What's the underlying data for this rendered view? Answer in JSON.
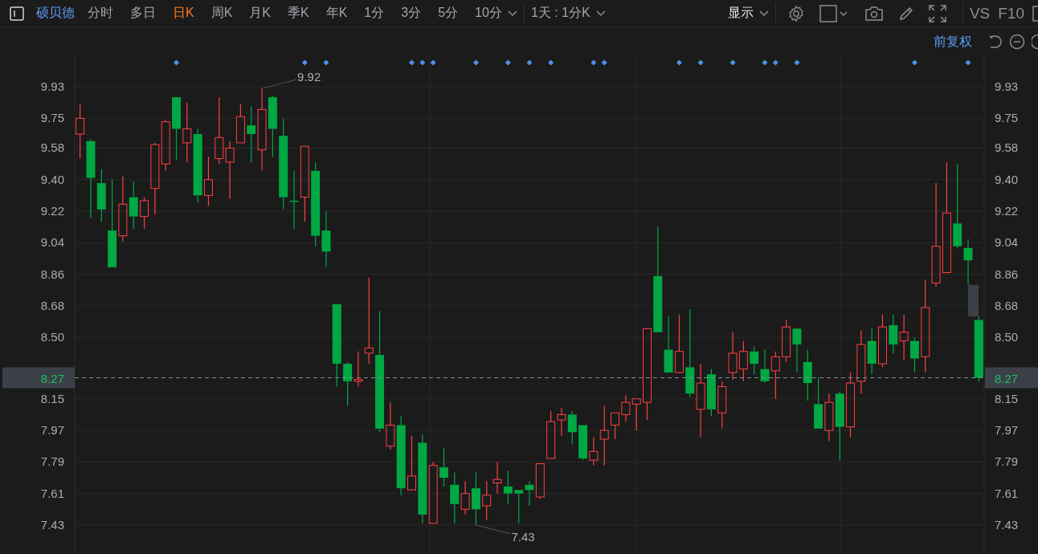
{
  "toolbar": {
    "symbol": "硕贝德",
    "tabs": [
      {
        "label": "分时",
        "selected": false
      },
      {
        "label": "多日",
        "selected": false
      },
      {
        "label": "日K",
        "selected": true
      },
      {
        "label": "周K",
        "selected": false
      },
      {
        "label": "月K",
        "selected": false
      },
      {
        "label": "季K",
        "selected": false
      },
      {
        "label": "年K",
        "selected": false
      },
      {
        "label": "1分",
        "selected": false
      },
      {
        "label": "3分",
        "selected": false
      },
      {
        "label": "5分",
        "selected": false
      },
      {
        "label": "10分",
        "selected": false
      }
    ],
    "interval": "1天 : 1分K",
    "display": "显示",
    "compare": "VS",
    "f10": "F10"
  },
  "subbar": {
    "adjust": "前复权"
  },
  "chart": {
    "chart_data": {
      "type": "candlestick",
      "grid": true,
      "ylim": [
        7.265,
        10.104
      ],
      "yticks": [
        {
          "value": 9.93,
          "label": "9.93"
        },
        {
          "value": 9.75,
          "label": "9.75"
        },
        {
          "value": 9.58,
          "label": "9.58"
        },
        {
          "value": 9.4,
          "label": "9.40"
        },
        {
          "value": 9.22,
          "label": "9.22"
        },
        {
          "value": 9.04,
          "label": "9.04"
        },
        {
          "value": 8.86,
          "label": "8.86"
        },
        {
          "value": 8.68,
          "label": "8.68"
        },
        {
          "value": 8.5,
          "label": "8.50"
        },
        {
          "value": 8.15,
          "label": "8.15"
        },
        {
          "value": 7.97,
          "label": "7.97"
        },
        {
          "value": 7.79,
          "label": "7.79"
        },
        {
          "value": 7.61,
          "label": "7.61"
        },
        {
          "value": 7.43,
          "label": "7.43"
        }
      ],
      "categories": [
        null,
        null,
        null,
        null,
        null,
        null,
        null,
        null,
        null,
        null,
        null,
        null,
        null,
        null,
        null,
        null,
        null,
        null,
        null,
        null,
        null,
        null,
        null,
        null,
        null,
        null,
        null,
        null,
        null,
        null,
        null,
        null,
        null,
        null,
        null,
        null,
        null,
        null,
        null,
        null,
        null,
        null,
        null,
        null,
        null,
        null,
        null,
        null,
        null,
        null,
        null,
        null,
        null,
        null,
        null,
        null,
        null,
        null,
        null,
        null,
        null,
        null,
        null,
        null,
        null,
        null,
        null,
        null,
        null,
        null,
        null,
        null,
        null,
        null,
        null,
        null,
        null,
        null,
        null,
        null,
        null,
        null,
        null,
        null,
        null
      ],
      "ohlc": [
        [
          9.66,
          9.83,
          9.52,
          9.75
        ],
        [
          9.62,
          9.63,
          9.18,
          9.41
        ],
        [
          9.38,
          9.46,
          9.16,
          9.23
        ],
        [
          9.11,
          9.4,
          8.9,
          8.9
        ],
        [
          9.08,
          9.42,
          9.05,
          9.26
        ],
        [
          9.3,
          9.39,
          9.12,
          9.19
        ],
        [
          9.19,
          9.3,
          9.12,
          9.28
        ],
        [
          9.35,
          9.61,
          9.2,
          9.6
        ],
        [
          9.49,
          9.74,
          9.45,
          9.73
        ],
        [
          9.87,
          9.87,
          9.51,
          9.69
        ],
        [
          9.61,
          9.84,
          9.5,
          9.69
        ],
        [
          9.66,
          9.69,
          9.27,
          9.31
        ],
        [
          9.31,
          9.53,
          9.25,
          9.4
        ],
        [
          9.52,
          9.87,
          9.49,
          9.64
        ],
        [
          9.5,
          9.62,
          9.29,
          9.58
        ],
        [
          9.61,
          9.83,
          9.61,
          9.76
        ],
        [
          9.71,
          9.82,
          9.5,
          9.66
        ],
        [
          9.57,
          9.92,
          9.45,
          9.8
        ],
        [
          9.87,
          9.88,
          9.53,
          9.69
        ],
        [
          9.65,
          9.75,
          9.23,
          9.3
        ],
        [
          9.28,
          9.45,
          9.12,
          9.28
        ],
        [
          9.3,
          9.59,
          9.16,
          9.59
        ],
        [
          9.45,
          9.5,
          9.02,
          9.08
        ],
        [
          9.11,
          9.22,
          8.9,
          8.99
        ],
        [
          8.69,
          8.69,
          8.22,
          8.35
        ],
        [
          8.35,
          8.36,
          8.11,
          8.25
        ],
        [
          8.25,
          8.42,
          8.22,
          8.26
        ],
        [
          8.41,
          8.84,
          8.35,
          8.44
        ],
        [
          8.4,
          8.65,
          7.96,
          7.98
        ],
        [
          7.88,
          8.13,
          7.86,
          8.0
        ],
        [
          8.0,
          8.05,
          7.6,
          7.64
        ],
        [
          7.63,
          7.94,
          7.63,
          7.71
        ],
        [
          7.9,
          7.95,
          7.44,
          7.49
        ],
        [
          7.44,
          7.79,
          7.44,
          7.77
        ],
        [
          7.76,
          7.87,
          7.65,
          7.7
        ],
        [
          7.66,
          7.73,
          7.44,
          7.55
        ],
        [
          7.52,
          7.68,
          7.49,
          7.61
        ],
        [
          7.64,
          7.73,
          7.43,
          7.52
        ],
        [
          7.54,
          7.68,
          7.46,
          7.6
        ],
        [
          7.67,
          7.79,
          7.61,
          7.69
        ],
        [
          7.65,
          7.74,
          7.55,
          7.61
        ],
        [
          7.63,
          7.63,
          7.44,
          7.61
        ],
        [
          7.66,
          7.68,
          7.54,
          7.63
        ],
        [
          7.59,
          7.78,
          7.58,
          7.78
        ],
        [
          7.81,
          8.08,
          7.81,
          8.02
        ],
        [
          8.03,
          8.1,
          7.94,
          8.06
        ],
        [
          8.06,
          8.08,
          7.89,
          7.96
        ],
        [
          8.0,
          8.0,
          7.8,
          7.81
        ],
        [
          7.8,
          7.93,
          7.77,
          7.85
        ],
        [
          7.92,
          8.11,
          7.77,
          7.97
        ],
        [
          8.0,
          8.07,
          7.92,
          8.07
        ],
        [
          8.06,
          8.17,
          8.02,
          8.13
        ],
        [
          8.12,
          8.15,
          7.97,
          8.15
        ],
        [
          8.13,
          8.55,
          8.03,
          8.55
        ],
        [
          8.85,
          9.13,
          8.53,
          8.53
        ],
        [
          8.43,
          8.62,
          8.3,
          8.3
        ],
        [
          8.3,
          8.63,
          8.3,
          8.42
        ],
        [
          8.33,
          8.66,
          8.16,
          8.18
        ],
        [
          8.09,
          8.35,
          7.93,
          8.24
        ],
        [
          8.29,
          8.32,
          8.05,
          8.09
        ],
        [
          8.07,
          8.25,
          7.98,
          8.22
        ],
        [
          8.3,
          8.53,
          8.26,
          8.41
        ],
        [
          8.32,
          8.48,
          8.25,
          8.42
        ],
        [
          8.42,
          8.45,
          8.29,
          8.35
        ],
        [
          8.32,
          8.43,
          8.24,
          8.25
        ],
        [
          8.31,
          8.42,
          8.15,
          8.39
        ],
        [
          8.39,
          8.6,
          8.36,
          8.56
        ],
        [
          8.55,
          8.55,
          8.3,
          8.46
        ],
        [
          8.36,
          8.43,
          8.14,
          8.24
        ],
        [
          8.12,
          8.27,
          7.98,
          7.98
        ],
        [
          7.97,
          8.18,
          7.91,
          8.13
        ],
        [
          8.18,
          8.19,
          7.8,
          7.99
        ],
        [
          7.99,
          8.3,
          7.93,
          8.24
        ],
        [
          8.25,
          8.54,
          8.18,
          8.46
        ],
        [
          8.48,
          8.55,
          8.29,
          8.35
        ],
        [
          8.35,
          8.63,
          8.33,
          8.56
        ],
        [
          8.57,
          8.63,
          8.41,
          8.46
        ],
        [
          8.48,
          8.63,
          8.37,
          8.53
        ],
        [
          8.48,
          8.5,
          8.3,
          8.38
        ],
        [
          8.39,
          8.83,
          8.3,
          8.67
        ],
        [
          8.81,
          9.38,
          8.79,
          9.02
        ],
        [
          8.87,
          9.5,
          8.87,
          9.21
        ],
        [
          9.15,
          9.49,
          9.01,
          9.02
        ],
        [
          9.01,
          9.06,
          8.8,
          8.94
        ],
        [
          8.6,
          8.62,
          8.25,
          8.27
        ]
      ],
      "ref_lines": [
        {
          "axis": "y",
          "value": 8.27,
          "label": "8.27"
        }
      ],
      "annotations": [
        "9.92",
        "7.43",
        "8.27"
      ]
    }
  }
}
